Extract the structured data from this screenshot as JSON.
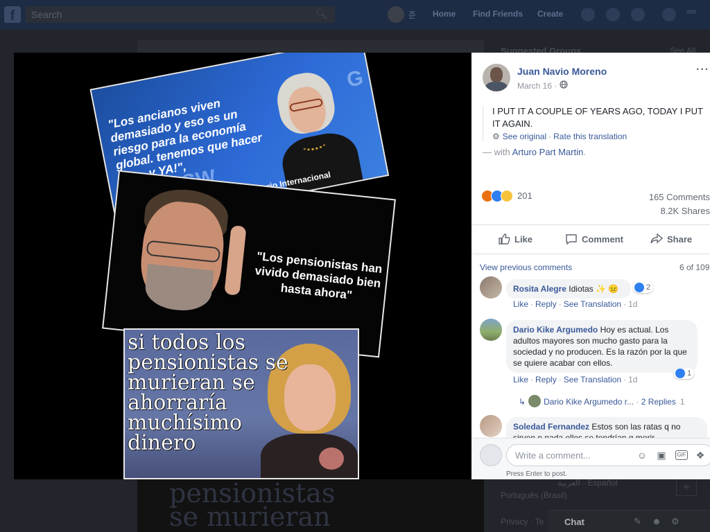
{
  "topbar": {
    "search_placeholder": "Search",
    "username": "준",
    "nav": [
      "Home",
      "Find Friends",
      "Create"
    ]
  },
  "background": {
    "right_header": "Suggested Groups",
    "see_all": "See All",
    "languages": "Português (Brasil)",
    "lang_row": "العربية · Español",
    "privacy": "Privacy · Te",
    "chat_label": "Chat",
    "strip_lines": [
      "pensionistas",
      "se murieran"
    ]
  },
  "meme": {
    "quote_top": "\"Los ancianos viven demasiado y eso es un riesgo para la economía global. tenemos que hacer algo, y YA!\",",
    "caption_top": "Fondo Monetario Internacional",
    "brand": "GSW",
    "quote_mid": "\"Los pensionistas han vivido demasiado bien hasta ahora\"",
    "quote_bottom": "si todos los pensionistas se murieran se ahorraría muchísimo dinero"
  },
  "post": {
    "author": "Juan Navio Moreno",
    "date": "March 16 ·",
    "text": "I PUT IT A COUPLE OF YEARS AGO, TODAY I PUT IT AGAIN.",
    "see_original": "See original",
    "rate_translation": "Rate this translation",
    "with_prefix": "— with",
    "with_name": "Arturo Part Martin",
    "with_suffix": ".",
    "reaction_count": "201",
    "comments_count": "165 Comments",
    "shares_count": "8.2K Shares",
    "actions": {
      "like": "Like",
      "comment": "Comment",
      "share": "Share"
    }
  },
  "comments_section": {
    "view_previous": "View previous comments",
    "page_count": "6 of 109",
    "items": [
      {
        "author": "Rosita Alegre",
        "text": "Idiotas ✨ 😐",
        "likes": "2",
        "actions": [
          "Like",
          "Reply",
          "See Translation"
        ],
        "time": "1d"
      },
      {
        "author": "Dario Kike Argumedo",
        "text": "Hoy es actual. Los adultos mayores son mucho gasto para la sociedad y no producen. Es la razón por la que se quiere acabar con ellos.",
        "likes": "1",
        "actions": [
          "Like",
          "Reply",
          "See Translation"
        ],
        "time": "1d"
      },
      {
        "author": "Soledad Fernandez",
        "text": "Estos son las ratas q no sirven p nada ellos se tendrían q morir"
      }
    ],
    "reply_author": "Dario Kike Argumedo r...",
    "reply_count": "2 Replies",
    "reply_time": "1"
  },
  "composer": {
    "placeholder": "Write a comment...",
    "hint": "Press Enter to post."
  },
  "colors": {
    "link_blue": "#385898",
    "like_blue": "#2e7ff0",
    "angry_orange": "#e9710f",
    "sad_yellow": "#f7c33b"
  }
}
